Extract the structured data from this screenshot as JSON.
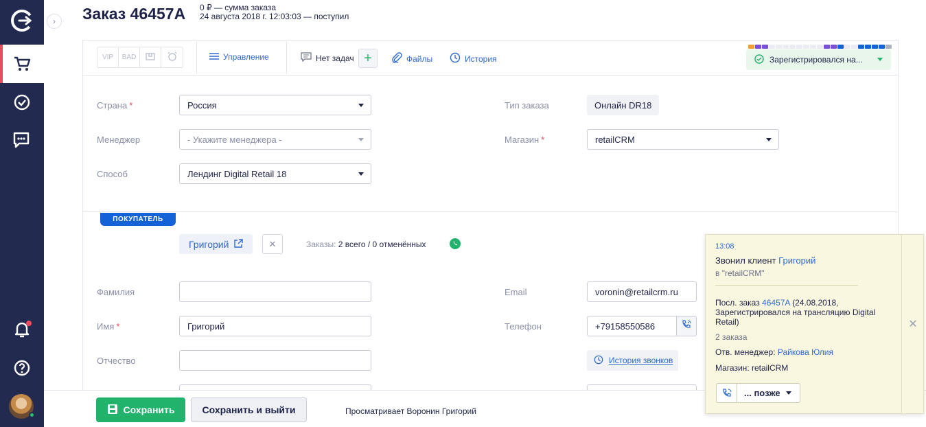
{
  "order": {
    "title": "Заказ 46457A",
    "sum_line": "0 ₽ — сумма заказа",
    "date_line": "24 августа 2018 г. 12:03:03 — поступил"
  },
  "toolbar": {
    "tags": [
      "VIP",
      "BAD"
    ],
    "manage": "Управление",
    "tasks": "Нет задач",
    "files": "Файлы",
    "history": "История",
    "status": "Зарегистрировался на..."
  },
  "colors": {
    "nav": "#232a4f",
    "accent": "#21b36b",
    "link": "#2f6ad0",
    "badge": "#1462d8",
    "active": "#e84a5f",
    "status_bar": [
      "#f0a030",
      "#7b4fd6",
      "#7b4fd6",
      "#e9ecf2",
      "#e9ecf2",
      "#e9ecf2",
      "#e9ecf2",
      "#e9ecf2",
      "#e9ecf2",
      "#e9ecf2",
      "#e9ecf2",
      "#7b4fd6",
      "#7b4fd6",
      "#1462d8",
      "#e9ecf2",
      "#e9ecf2",
      "#1462d8",
      "#1462d8",
      "#1462d8",
      "#1462d8",
      "#aab0c0"
    ]
  },
  "main_fields": {
    "country_label": "Страна",
    "country": "Россия",
    "manager_label": "Менеджер",
    "manager_placeholder": "- Укажите менеджера -",
    "method_label": "Способ",
    "method": "Лендинг Digital Retail 18",
    "order_type_label": "Тип заказа",
    "order_type": "Онлайн DR18",
    "shop_label": "Магазин",
    "shop": "retailCRM"
  },
  "customer": {
    "badge": "ПОКУПАТЕЛЬ",
    "name": "Григорий",
    "orders_label": "Заказы:",
    "orders_value": "2 всего / 0 отменённых",
    "lastname_label": "Фамилия",
    "firstname_label": "Имя",
    "firstname": "Григорий",
    "patronymic_label": "Отчество",
    "email_label": "Email",
    "email": "voronin@retailcrm.ru",
    "phone_label": "Телефон",
    "phone": "+79158550586",
    "call_history": "История звонков"
  },
  "footer": {
    "save": "Сохранить",
    "save_exit": "Сохранить и выйти",
    "viewing": "Просматривает Воронин Григорий"
  },
  "popup": {
    "time": "13:08",
    "called_prefix": "Звонил клиент",
    "client": "Григорий",
    "shop_line": "в \"retailCRM\"",
    "last_order_prefix": "Посл. заказ",
    "last_order": "46457A",
    "last_order_info": "(24.08.2018,",
    "last_order_info2": "Зарегистрировался на трансляцию Digital",
    "last_order_info3": "Retail)",
    "orders_count": "2 заказа",
    "manager_prefix": "Отв. менеджер:",
    "manager": "Райкова Юлия",
    "shop": "Магазин: retailCRM",
    "later": "... позже"
  }
}
